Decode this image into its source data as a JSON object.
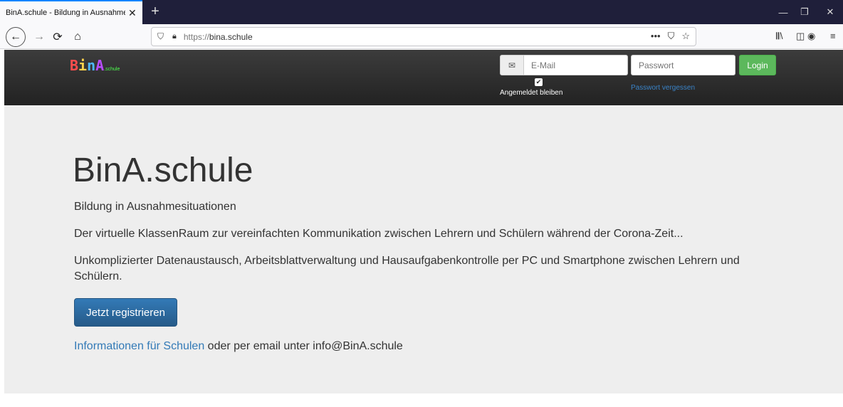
{
  "browser": {
    "tab_title": "BinA.schule - Bildung in Ausnahme",
    "new_tab_icon": "+",
    "url_scheme": "https://",
    "url_host": "bina.schule"
  },
  "header": {
    "logo": {
      "l1": "B",
      "l2": "i",
      "l3": "n",
      "l4": "A",
      "sub": ".schule"
    },
    "email_placeholder": "E-Mail",
    "password_placeholder": "Passwort",
    "login_label": "Login",
    "remember_label": "Angemeldet bleiben",
    "remember_checked": true,
    "forgot_label": "Passwort vergessen"
  },
  "main": {
    "title": "BinA.schule",
    "subtitle": "Bildung in Ausnahmesituationen",
    "intro": "Der virtuelle KlassenRaum zur vereinfachten Kommunikation zwischen Lehrern und Schülern während der Corona-Zeit...",
    "description": "Unkomplizierter Datenaustausch, Arbeitsblattverwaltung und Hausaufgabenkontrolle per PC und Smartphone zwischen Lehrern und Schülern.",
    "register_label": "Jetzt registrieren",
    "info_link": "Informationen für Schulen",
    "info_suffix": " oder per email unter info@BinA.schule"
  },
  "colors": {
    "header_bg": "#222222",
    "accent_blue": "#337ab7",
    "login_green": "#5cb85c",
    "jumbotron_bg": "#eeeeee"
  }
}
